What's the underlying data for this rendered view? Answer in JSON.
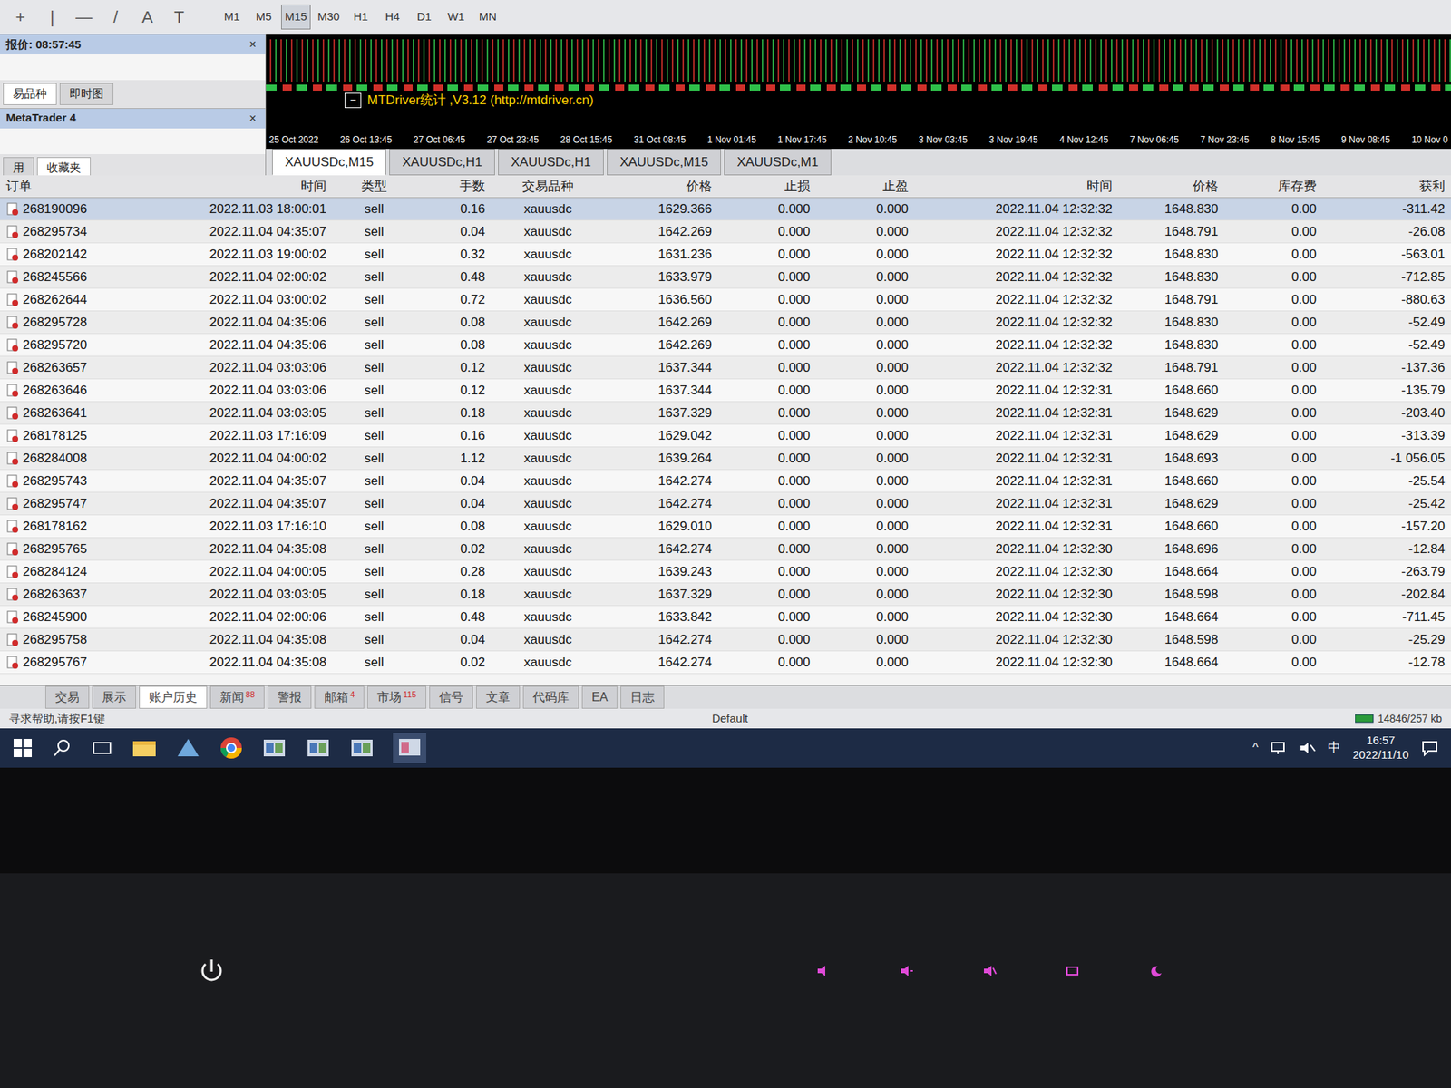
{
  "toolbar": {
    "tools": [
      "+",
      "|",
      "—",
      "/",
      "A",
      "T"
    ],
    "timeframes": [
      {
        "label": "M1",
        "selected": false
      },
      {
        "label": "M5",
        "selected": false
      },
      {
        "label": "M15",
        "selected": true
      },
      {
        "label": "M30",
        "selected": false
      },
      {
        "label": "H1",
        "selected": false
      },
      {
        "label": "H4",
        "selected": false
      },
      {
        "label": "D1",
        "selected": false
      },
      {
        "label": "W1",
        "selected": false
      },
      {
        "label": "MN",
        "selected": false
      }
    ]
  },
  "quote_panel": {
    "title": "报价: 08:57:45",
    "close": "×",
    "tabs": [
      {
        "label": "易品种",
        "selected": true
      },
      {
        "label": "即时图",
        "selected": false
      }
    ]
  },
  "navigator": {
    "title": "MetaTrader 4",
    "close": "×",
    "tabs": [
      {
        "label": "用",
        "selected": false
      },
      {
        "label": "收藏夹",
        "selected": true
      }
    ]
  },
  "chart": {
    "indicator": "MTDriver统计 ,V3.12 (http://mtdriver.cn)",
    "collapse": "−",
    "axis": [
      "25 Oct 2022",
      "26 Oct 13:45",
      "27 Oct 06:45",
      "27 Oct 23:45",
      "28 Oct 15:45",
      "31 Oct 08:45",
      "1 Nov 01:45",
      "1 Nov 17:45",
      "2 Nov 10:45",
      "3 Nov 03:45",
      "3 Nov 19:45",
      "4 Nov 12:45",
      "7 Nov 06:45",
      "7 Nov 23:45",
      "8 Nov 15:45",
      "9 Nov 08:45",
      "10 Nov 0"
    ]
  },
  "chart_tabs": [
    {
      "label": "XAUUSDc,M15",
      "selected": true
    },
    {
      "label": "XAUUSDc,H1",
      "selected": false
    },
    {
      "label": "XAUUSDc,H1",
      "selected": false
    },
    {
      "label": "XAUUSDc,M15",
      "selected": false
    },
    {
      "label": "XAUUSDc,M1",
      "selected": false
    }
  ],
  "table": {
    "columns": [
      "订单",
      "时间",
      "类型",
      "手数",
      "交易品种",
      "价格",
      "止损",
      "止盈",
      "时间",
      "价格",
      "库存费",
      "获利"
    ],
    "rows": [
      {
        "selected": true,
        "cells": [
          "268190096",
          "2022.11.03 18:00:01",
          "sell",
          "0.16",
          "xauusdc",
          "1629.366",
          "0.000",
          "0.000",
          "2022.11.04 12:32:32",
          "1648.830",
          "0.00",
          "-311.42"
        ]
      },
      {
        "selected": false,
        "cells": [
          "268295734",
          "2022.11.04 04:35:07",
          "sell",
          "0.04",
          "xauusdc",
          "1642.269",
          "0.000",
          "0.000",
          "2022.11.04 12:32:32",
          "1648.791",
          "0.00",
          "-26.08"
        ]
      },
      {
        "selected": false,
        "cells": [
          "268202142",
          "2022.11.03 19:00:02",
          "sell",
          "0.32",
          "xauusdc",
          "1631.236",
          "0.000",
          "0.000",
          "2022.11.04 12:32:32",
          "1648.830",
          "0.00",
          "-563.01"
        ]
      },
      {
        "selected": false,
        "cells": [
          "268245566",
          "2022.11.04 02:00:02",
          "sell",
          "0.48",
          "xauusdc",
          "1633.979",
          "0.000",
          "0.000",
          "2022.11.04 12:32:32",
          "1648.830",
          "0.00",
          "-712.85"
        ]
      },
      {
        "selected": false,
        "cells": [
          "268262644",
          "2022.11.04 03:00:02",
          "sell",
          "0.72",
          "xauusdc",
          "1636.560",
          "0.000",
          "0.000",
          "2022.11.04 12:32:32",
          "1648.791",
          "0.00",
          "-880.63"
        ]
      },
      {
        "selected": false,
        "cells": [
          "268295728",
          "2022.11.04 04:35:06",
          "sell",
          "0.08",
          "xauusdc",
          "1642.269",
          "0.000",
          "0.000",
          "2022.11.04 12:32:32",
          "1648.830",
          "0.00",
          "-52.49"
        ]
      },
      {
        "selected": false,
        "cells": [
          "268295720",
          "2022.11.04 04:35:06",
          "sell",
          "0.08",
          "xauusdc",
          "1642.269",
          "0.000",
          "0.000",
          "2022.11.04 12:32:32",
          "1648.830",
          "0.00",
          "-52.49"
        ]
      },
      {
        "selected": false,
        "cells": [
          "268263657",
          "2022.11.04 03:03:06",
          "sell",
          "0.12",
          "xauusdc",
          "1637.344",
          "0.000",
          "0.000",
          "2022.11.04 12:32:32",
          "1648.791",
          "0.00",
          "-137.36"
        ]
      },
      {
        "selected": false,
        "cells": [
          "268263646",
          "2022.11.04 03:03:06",
          "sell",
          "0.12",
          "xauusdc",
          "1637.344",
          "0.000",
          "0.000",
          "2022.11.04 12:32:31",
          "1648.660",
          "0.00",
          "-135.79"
        ]
      },
      {
        "selected": false,
        "cells": [
          "268263641",
          "2022.11.04 03:03:05",
          "sell",
          "0.18",
          "xauusdc",
          "1637.329",
          "0.000",
          "0.000",
          "2022.11.04 12:32:31",
          "1648.629",
          "0.00",
          "-203.40"
        ]
      },
      {
        "selected": false,
        "cells": [
          "268178125",
          "2022.11.03 17:16:09",
          "sell",
          "0.16",
          "xauusdc",
          "1629.042",
          "0.000",
          "0.000",
          "2022.11.04 12:32:31",
          "1648.629",
          "0.00",
          "-313.39"
        ]
      },
      {
        "selected": false,
        "cells": [
          "268284008",
          "2022.11.04 04:00:02",
          "sell",
          "1.12",
          "xauusdc",
          "1639.264",
          "0.000",
          "0.000",
          "2022.11.04 12:32:31",
          "1648.693",
          "0.00",
          "-1 056.05"
        ]
      },
      {
        "selected": false,
        "cells": [
          "268295743",
          "2022.11.04 04:35:07",
          "sell",
          "0.04",
          "xauusdc",
          "1642.274",
          "0.000",
          "0.000",
          "2022.11.04 12:32:31",
          "1648.660",
          "0.00",
          "-25.54"
        ]
      },
      {
        "selected": false,
        "cells": [
          "268295747",
          "2022.11.04 04:35:07",
          "sell",
          "0.04",
          "xauusdc",
          "1642.274",
          "0.000",
          "0.000",
          "2022.11.04 12:32:31",
          "1648.629",
          "0.00",
          "-25.42"
        ]
      },
      {
        "selected": false,
        "cells": [
          "268178162",
          "2022.11.03 17:16:10",
          "sell",
          "0.08",
          "xauusdc",
          "1629.010",
          "0.000",
          "0.000",
          "2022.11.04 12:32:31",
          "1648.660",
          "0.00",
          "-157.20"
        ]
      },
      {
        "selected": false,
        "cells": [
          "268295765",
          "2022.11.04 04:35:08",
          "sell",
          "0.02",
          "xauusdc",
          "1642.274",
          "0.000",
          "0.000",
          "2022.11.04 12:32:30",
          "1648.696",
          "0.00",
          "-12.84"
        ]
      },
      {
        "selected": false,
        "cells": [
          "268284124",
          "2022.11.04 04:00:05",
          "sell",
          "0.28",
          "xauusdc",
          "1639.243",
          "0.000",
          "0.000",
          "2022.11.04 12:32:30",
          "1648.664",
          "0.00",
          "-263.79"
        ]
      },
      {
        "selected": false,
        "cells": [
          "268263637",
          "2022.11.04 03:03:05",
          "sell",
          "0.18",
          "xauusdc",
          "1637.329",
          "0.000",
          "0.000",
          "2022.11.04 12:32:30",
          "1648.598",
          "0.00",
          "-202.84"
        ]
      },
      {
        "selected": false,
        "cells": [
          "268245900",
          "2022.11.04 02:00:06",
          "sell",
          "0.48",
          "xauusdc",
          "1633.842",
          "0.000",
          "0.000",
          "2022.11.04 12:32:30",
          "1648.664",
          "0.00",
          "-711.45"
        ]
      },
      {
        "selected": false,
        "cells": [
          "268295758",
          "2022.11.04 04:35:08",
          "sell",
          "0.04",
          "xauusdc",
          "1642.274",
          "0.000",
          "0.000",
          "2022.11.04 12:32:30",
          "1648.598",
          "0.00",
          "-25.29"
        ]
      },
      {
        "selected": false,
        "cells": [
          "268295767",
          "2022.11.04 04:35:08",
          "sell",
          "0.02",
          "xauusdc",
          "1642.274",
          "0.000",
          "0.000",
          "2022.11.04 12:32:30",
          "1648.664",
          "0.00",
          "-12.78"
        ]
      }
    ]
  },
  "terminal_tabs": [
    {
      "label": "交易",
      "badge": "",
      "selected": false
    },
    {
      "label": "展示",
      "badge": "",
      "selected": false
    },
    {
      "label": "账户历史",
      "badge": "",
      "selected": true
    },
    {
      "label": "新闻",
      "badge": "88",
      "selected": false
    },
    {
      "label": "警报",
      "badge": "",
      "selected": false
    },
    {
      "label": "邮箱",
      "badge": "4",
      "selected": false
    },
    {
      "label": "市场",
      "badge": "115",
      "selected": false
    },
    {
      "label": "信号",
      "badge": "",
      "selected": false
    },
    {
      "label": "文章",
      "badge": "",
      "selected": false
    },
    {
      "label": "代码库",
      "badge": "",
      "selected": false
    },
    {
      "label": "EA",
      "badge": "",
      "selected": false
    },
    {
      "label": "日志",
      "badge": "",
      "selected": false
    }
  ],
  "status_bar": {
    "help": "寻求帮助,请按F1键",
    "profile": "Default",
    "traffic": "14846/257 kb"
  },
  "taskbar": {
    "tray_arrow": "^",
    "ime": "中",
    "time": "16:57",
    "date": "2022/11/10"
  }
}
